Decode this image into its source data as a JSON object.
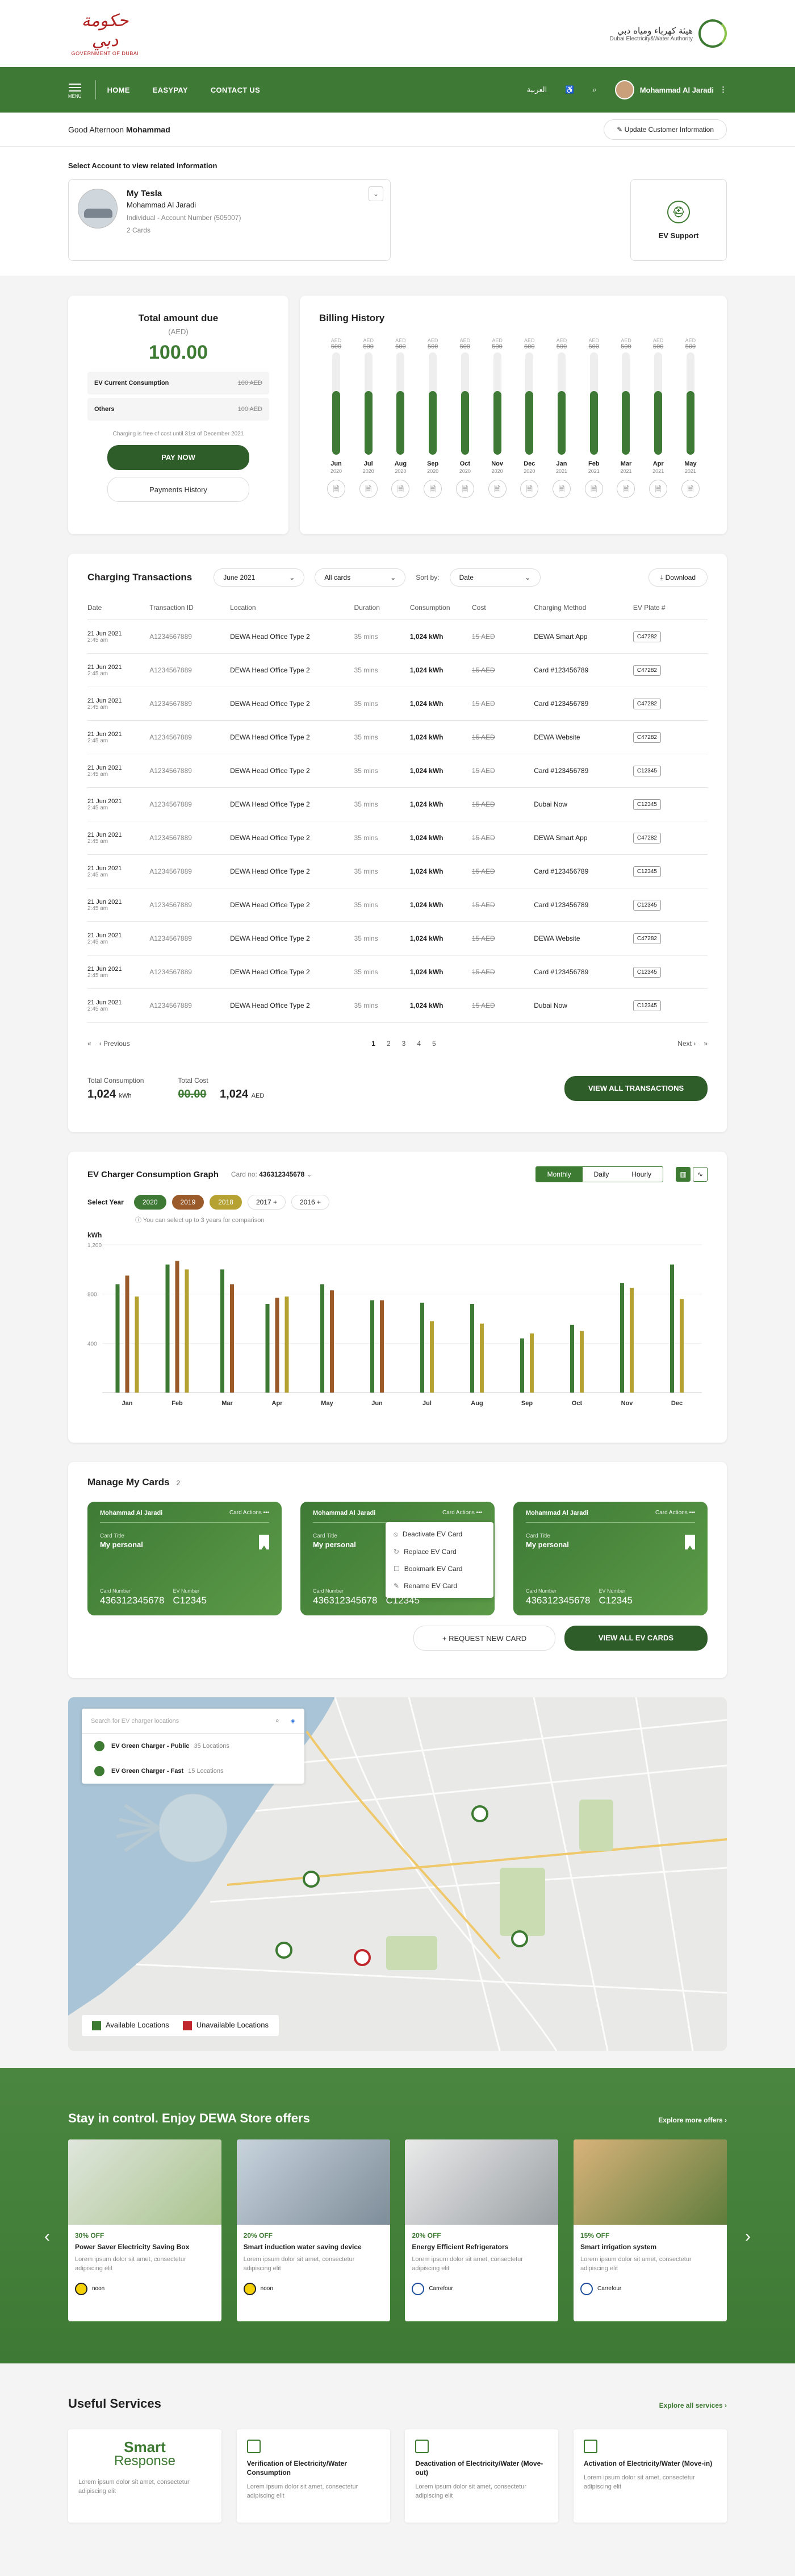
{
  "header": {
    "gov_logo_ar": "حكومة دبي",
    "gov_logo_en": "GOVERNMENT OF DUBAI",
    "dewa_ar": "هيئة كهرباء ومياه دبي",
    "dewa_en": "Dubai Electricity&Water Authority"
  },
  "nav": {
    "menu_label": "MENU",
    "links": [
      "HOME",
      "EASYPAY",
      "CONTACT US"
    ],
    "language": "العربية",
    "user_name": "Mohammad Al Jaradi"
  },
  "greeting": {
    "prefix": "Good Afternoon",
    "name": "Mohammad",
    "update_button": "Update Customer Information"
  },
  "account": {
    "select_label": "Select Account to view related information",
    "name": "My Tesla",
    "owner": "Mohammad Al Jaradi",
    "type_number": "Individual - Account Number (505007)",
    "cards": "2 Cards",
    "ev_support": "EV Support"
  },
  "total_due": {
    "title": "Total amount due",
    "currency": "(AED)",
    "amount": "100.00",
    "rows": [
      {
        "label": "EV Current Consumption",
        "value": "100 AED"
      },
      {
        "label": "Others",
        "value": "100 AED"
      }
    ],
    "note": "Charging is free of cost until 31st of December 2021",
    "pay_button": "PAY NOW",
    "history_button": "Payments History"
  },
  "billing_history": {
    "title": "Billing History",
    "unit": "AED",
    "months": [
      {
        "m": "Jun",
        "y": "2020",
        "v": "500",
        "fill": 0.62
      },
      {
        "m": "Jul",
        "y": "2020",
        "v": "500",
        "fill": 0.62
      },
      {
        "m": "Aug",
        "y": "2020",
        "v": "500",
        "fill": 0.62
      },
      {
        "m": "Sep",
        "y": "2020",
        "v": "500",
        "fill": 0.62
      },
      {
        "m": "Oct",
        "y": "2020",
        "v": "500",
        "fill": 0.62
      },
      {
        "m": "Nov",
        "y": "2020",
        "v": "500",
        "fill": 0.62
      },
      {
        "m": "Dec",
        "y": "2020",
        "v": "500",
        "fill": 0.62
      },
      {
        "m": "Jan",
        "y": "2021",
        "v": "500",
        "fill": 0.62
      },
      {
        "m": "Feb",
        "y": "2021",
        "v": "500",
        "fill": 0.62
      },
      {
        "m": "Mar",
        "y": "2021",
        "v": "500",
        "fill": 0.62
      },
      {
        "m": "Apr",
        "y": "2021",
        "v": "500",
        "fill": 0.62
      },
      {
        "m": "May",
        "y": "2021",
        "v": "500",
        "fill": 0.62
      }
    ]
  },
  "transactions": {
    "title": "Charging Transactions",
    "month_filter": "June 2021",
    "card_filter": "All cards",
    "sort_label": "Sort by:",
    "sort_value": "Date",
    "download": "Download",
    "columns": [
      "Date",
      "Transaction ID",
      "Location",
      "Duration",
      "Consumption",
      "Cost",
      "Charging Method",
      "EV Plate #"
    ],
    "rows": [
      {
        "date": "21 Jun 2021",
        "time": "2:45 am",
        "id": "A1234567889",
        "loc": "DEWA Head Office Type 2",
        "dur": "35 mins",
        "cons": "1,024 kWh",
        "cost": "15 AED",
        "method": "DEWA Smart App",
        "plate": "C47282"
      },
      {
        "date": "21 Jun 2021",
        "time": "2:45 am",
        "id": "A1234567889",
        "loc": "DEWA Head Office Type 2",
        "dur": "35 mins",
        "cons": "1,024 kWh",
        "cost": "15 AED",
        "method": "Card #123456789",
        "plate": "C47282"
      },
      {
        "date": "21 Jun 2021",
        "time": "2:45 am",
        "id": "A1234567889",
        "loc": "DEWA Head Office Type 2",
        "dur": "35 mins",
        "cons": "1,024 kWh",
        "cost": "15 AED",
        "method": "Card #123456789",
        "plate": "C47282"
      },
      {
        "date": "21 Jun 2021",
        "time": "2:45 am",
        "id": "A1234567889",
        "loc": "DEWA Head Office Type 2",
        "dur": "35 mins",
        "cons": "1,024 kWh",
        "cost": "15 AED",
        "method": "DEWA Website",
        "plate": "C47282"
      },
      {
        "date": "21 Jun 2021",
        "time": "2:45 am",
        "id": "A1234567889",
        "loc": "DEWA Head Office Type 2",
        "dur": "35 mins",
        "cons": "1,024 kWh",
        "cost": "15 AED",
        "method": "Card #123456789",
        "plate": "C12345"
      },
      {
        "date": "21 Jun 2021",
        "time": "2:45 am",
        "id": "A1234567889",
        "loc": "DEWA Head Office Type 2",
        "dur": "35 mins",
        "cons": "1,024 kWh",
        "cost": "15 AED",
        "method": "Dubai Now",
        "plate": "C12345"
      },
      {
        "date": "21 Jun 2021",
        "time": "2:45 am",
        "id": "A1234567889",
        "loc": "DEWA Head Office Type 2",
        "dur": "35 mins",
        "cons": "1,024 kWh",
        "cost": "15 AED",
        "method": "DEWA Smart App",
        "plate": "C47282"
      },
      {
        "date": "21 Jun 2021",
        "time": "2:45 am",
        "id": "A1234567889",
        "loc": "DEWA Head Office Type 2",
        "dur": "35 mins",
        "cons": "1,024 kWh",
        "cost": "15 AED",
        "method": "Card #123456789",
        "plate": "C12345"
      },
      {
        "date": "21 Jun 2021",
        "time": "2:45 am",
        "id": "A1234567889",
        "loc": "DEWA Head Office Type 2",
        "dur": "35 mins",
        "cons": "1,024 kWh",
        "cost": "15 AED",
        "method": "Card #123456789",
        "plate": "C12345"
      },
      {
        "date": "21 Jun 2021",
        "time": "2:45 am",
        "id": "A1234567889",
        "loc": "DEWA Head Office Type 2",
        "dur": "35 mins",
        "cons": "1,024 kWh",
        "cost": "15 AED",
        "method": "DEWA Website",
        "plate": "C47282"
      },
      {
        "date": "21 Jun 2021",
        "time": "2:45 am",
        "id": "A1234567889",
        "loc": "DEWA Head Office Type 2",
        "dur": "35 mins",
        "cons": "1,024 kWh",
        "cost": "15 AED",
        "method": "Card #123456789",
        "plate": "C12345"
      },
      {
        "date": "21 Jun 2021",
        "time": "2:45 am",
        "id": "A1234567889",
        "loc": "DEWA Head Office Type 2",
        "dur": "35 mins",
        "cons": "1,024 kWh",
        "cost": "15 AED",
        "method": "Dubai Now",
        "plate": "C12345"
      }
    ],
    "pager": {
      "prev": "Previous",
      "next": "Next",
      "pages": [
        "1",
        "2",
        "3",
        "4",
        "5"
      ]
    },
    "total_consumption_label": "Total Consumption",
    "total_consumption": "1,024",
    "total_consumption_unit": "kWh",
    "total_cost_label": "Total Cost",
    "total_cost_struck": "00.00",
    "total_cost": "1,024",
    "total_cost_unit": "AED",
    "view_all": "VIEW ALL TRANSACTIONS"
  },
  "consumption_graph": {
    "title": "EV Charger Consumption Graph",
    "card_label": "Card no:",
    "card_number": "436312345678",
    "toggles": [
      "Monthly",
      "Daily",
      "Hourly"
    ],
    "year_label": "Select Year",
    "years": [
      "2020",
      "2019",
      "2018",
      "2017",
      "2016"
    ],
    "hint": "You can select up to 3 years for comparison",
    "colors": {
      "2020": "#3e7a35",
      "2019": "#9a5a2a",
      "2018": "#b5a233"
    }
  },
  "chart_data": {
    "type": "bar",
    "ylabel": "kWh",
    "ylim": [
      0,
      1200
    ],
    "yticks": [
      "1,200",
      "800",
      "400"
    ],
    "categories": [
      "Jan",
      "Feb",
      "Mar",
      "Apr",
      "May",
      "Jun",
      "Jul",
      "Aug",
      "Sep",
      "Oct",
      "Nov",
      "Dec"
    ],
    "series": [
      {
        "name": "2020",
        "color": "#3e7a35",
        "values": [
          880,
          1040,
          1000,
          720,
          880,
          750,
          730,
          720,
          440,
          550,
          890,
          1040
        ]
      },
      {
        "name": "2019",
        "color": "#9a5a2a",
        "values": [
          950,
          1070,
          880,
          770,
          830,
          750,
          0,
          0,
          0,
          0,
          0,
          0
        ]
      },
      {
        "name": "2018",
        "color": "#b5a233",
        "values": [
          780,
          1000,
          0,
          780,
          0,
          0,
          580,
          560,
          480,
          500,
          850,
          760
        ]
      }
    ]
  },
  "manage_cards": {
    "title": "Manage My Cards",
    "count": "2",
    "cards": [
      {
        "holder": "Mohammad Al Jaradi",
        "actions": "Card Actions",
        "title_label": "Card Title",
        "title": "My personal",
        "number_label": "Card Number",
        "number": "436312345678",
        "ev_label": "EV Number",
        "ev": "C12345"
      },
      {
        "holder": "Mohammad Al Jaradi",
        "actions": "Card Actions",
        "title_label": "Card Title",
        "title": "My personal",
        "number_label": "Card Number",
        "number": "436312345678",
        "ev_label": "EV Number",
        "ev": "C12345"
      },
      {
        "holder": "Mohammad Al Jaradi",
        "actions": "Card Actions",
        "title_label": "Card Title",
        "title": "My personal",
        "number_label": "Card Number",
        "number": "436312345678",
        "ev_label": "EV Number",
        "ev": "C12345"
      }
    ],
    "menu": [
      "Deactivate EV Card",
      "Replace EV Card",
      "Bookmark EV Card",
      "Rename EV Card"
    ],
    "request_button": "REQUEST NEW CARD",
    "view_all_button": "VIEW ALL EV CARDS"
  },
  "map": {
    "search_placeholder": "Search for EV charger locations",
    "options": [
      {
        "name": "EV Green Charger - Public",
        "count": "35 Locations"
      },
      {
        "name": "EV Green Charger - Fast",
        "count": "15 Locations"
      }
    ],
    "legend_available": "Available Locations",
    "legend_unavailable": "Unavailable Locations",
    "available_color": "#3d7a32",
    "unavailable_color": "#c0272d"
  },
  "store": {
    "title": "Stay in control. Enjoy DEWA Store offers",
    "explore": "Explore more offers",
    "offers": [
      {
        "pct": "30% OFF",
        "name": "Power Saver Electricity Saving Box",
        "desc": "Lorem ipsum dolor sit amet, consectetur adipiscing elit",
        "brand": "noon"
      },
      {
        "pct": "20% OFF",
        "name": "Smart induction water saving device",
        "desc": "Lorem ipsum dolor sit amet, consectetur adipiscing elit",
        "brand": "noon"
      },
      {
        "pct": "20% OFF",
        "name": "Energy Efficient Refrigerators",
        "desc": "Lorem ipsum dolor sit amet, consectetur adipiscing elit",
        "brand": "Carrefour"
      },
      {
        "pct": "15% OFF",
        "name": "Smart irrigation system",
        "desc": "Lorem ipsum dolor sit amet, consectetur adipiscing elit",
        "brand": "Carrefour"
      }
    ]
  },
  "useful": {
    "title": "Useful Services",
    "explore": "Explore all services",
    "smart_response": "Smart",
    "smart_response_2": "Response",
    "services": [
      {
        "name": "",
        "desc": "Lorem ipsum dolor sit amet, consectetur adipiscing elit"
      },
      {
        "name": "Verification of Electricity/Water Consumption",
        "desc": "Lorem ipsum dolor sit amet, consectetur adipiscing elit"
      },
      {
        "name": "Deactivation of Electricity/Water (Move-out)",
        "desc": "Lorem ipsum dolor sit amet, consectetur adipiscing elit"
      },
      {
        "name": "Activation of Electricity/Water (Move-in)",
        "desc": "Lorem ipsum dolor sit amet, consectetur adipiscing elit"
      }
    ]
  }
}
